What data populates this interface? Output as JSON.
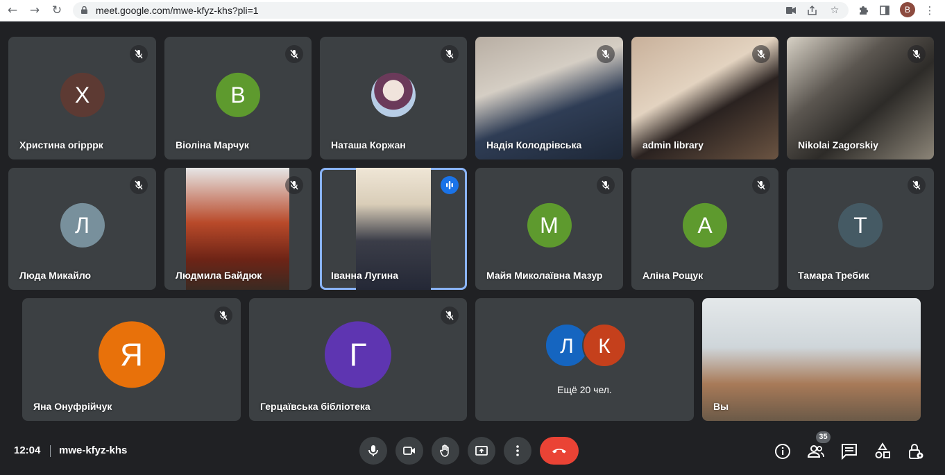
{
  "browser": {
    "url": "meet.google.com/mwe-kfyz-khs?pli=1",
    "profile_initial": "B",
    "nav_icons": [
      "back-arrow-icon",
      "forward-arrow-icon",
      "reload-icon"
    ],
    "toolbar_icons": [
      "camera-blocked-icon",
      "share-icon",
      "bookmark-star-icon",
      "extensions-puzzle-icon",
      "side-panel-icon",
      "menu-dots-icon"
    ]
  },
  "tiles": [
    {
      "name": "Христина огірррк",
      "initial": "Х",
      "color": "#5d3a33",
      "muted": true
    },
    {
      "name": "Віоліна Марчук",
      "initial": "В",
      "color": "#5e9a2e",
      "muted": true
    },
    {
      "name": "Наташа Коржан",
      "initial": "",
      "color": "#c9d7e8",
      "muted": true
    },
    {
      "name": "Надія Колодрівська",
      "initial": "",
      "color": "#8a7a6a",
      "muted": true
    },
    {
      "name": "admin library",
      "initial": "",
      "color": "#7a6250",
      "muted": true
    },
    {
      "name": "Nikolai Zagorskiy",
      "initial": "",
      "color": "#6a6155",
      "muted": true
    },
    {
      "name": "Люда Микайло",
      "initial": "Л",
      "color": "#78909c",
      "muted": true
    },
    {
      "name": "Людмила Байдюк",
      "initial": "",
      "color": "#7a2a1e",
      "muted": true
    },
    {
      "name": "Іванна Лугина",
      "initial": "",
      "color": "#cfc7b8",
      "muted": false,
      "speaking": true
    },
    {
      "name": "Майя Миколаївна Мазур",
      "initial": "М",
      "color": "#5e9a2e",
      "muted": true
    },
    {
      "name": "Аліна Рощук",
      "initial": "А",
      "color": "#5e9a2e",
      "muted": true
    },
    {
      "name": "Тамара Требик",
      "initial": "Т",
      "color": "#455a64",
      "muted": true
    },
    {
      "name": "Яна Онуфрійчук",
      "initial": "Я",
      "color": "#e8710a",
      "muted": true
    },
    {
      "name": "Герцаївська бібліотека",
      "initial": "Г",
      "color": "#5e35b1",
      "muted": true
    },
    {
      "name": "",
      "initial": "",
      "color": "#3c4043",
      "muted": false
    },
    {
      "name": "Вы",
      "initial": "",
      "color": "#d8dde0",
      "muted": false
    }
  ],
  "others": {
    "label": "Ещё 20 чел.",
    "avatars": [
      {
        "initial": "Л",
        "color": "#1565c0"
      },
      {
        "initial": "К",
        "color": "#c5401c"
      }
    ]
  },
  "controls": {
    "time": "12:04",
    "meeting_code": "mwe-kfyz-khs",
    "people_count": "35",
    "buttons": [
      "mic-button",
      "camera-button",
      "raise-hand-button",
      "present-button",
      "more-options-button",
      "end-call-button"
    ],
    "right_buttons": [
      "info-button",
      "people-button",
      "chat-button",
      "activities-button",
      "host-controls-button"
    ]
  }
}
